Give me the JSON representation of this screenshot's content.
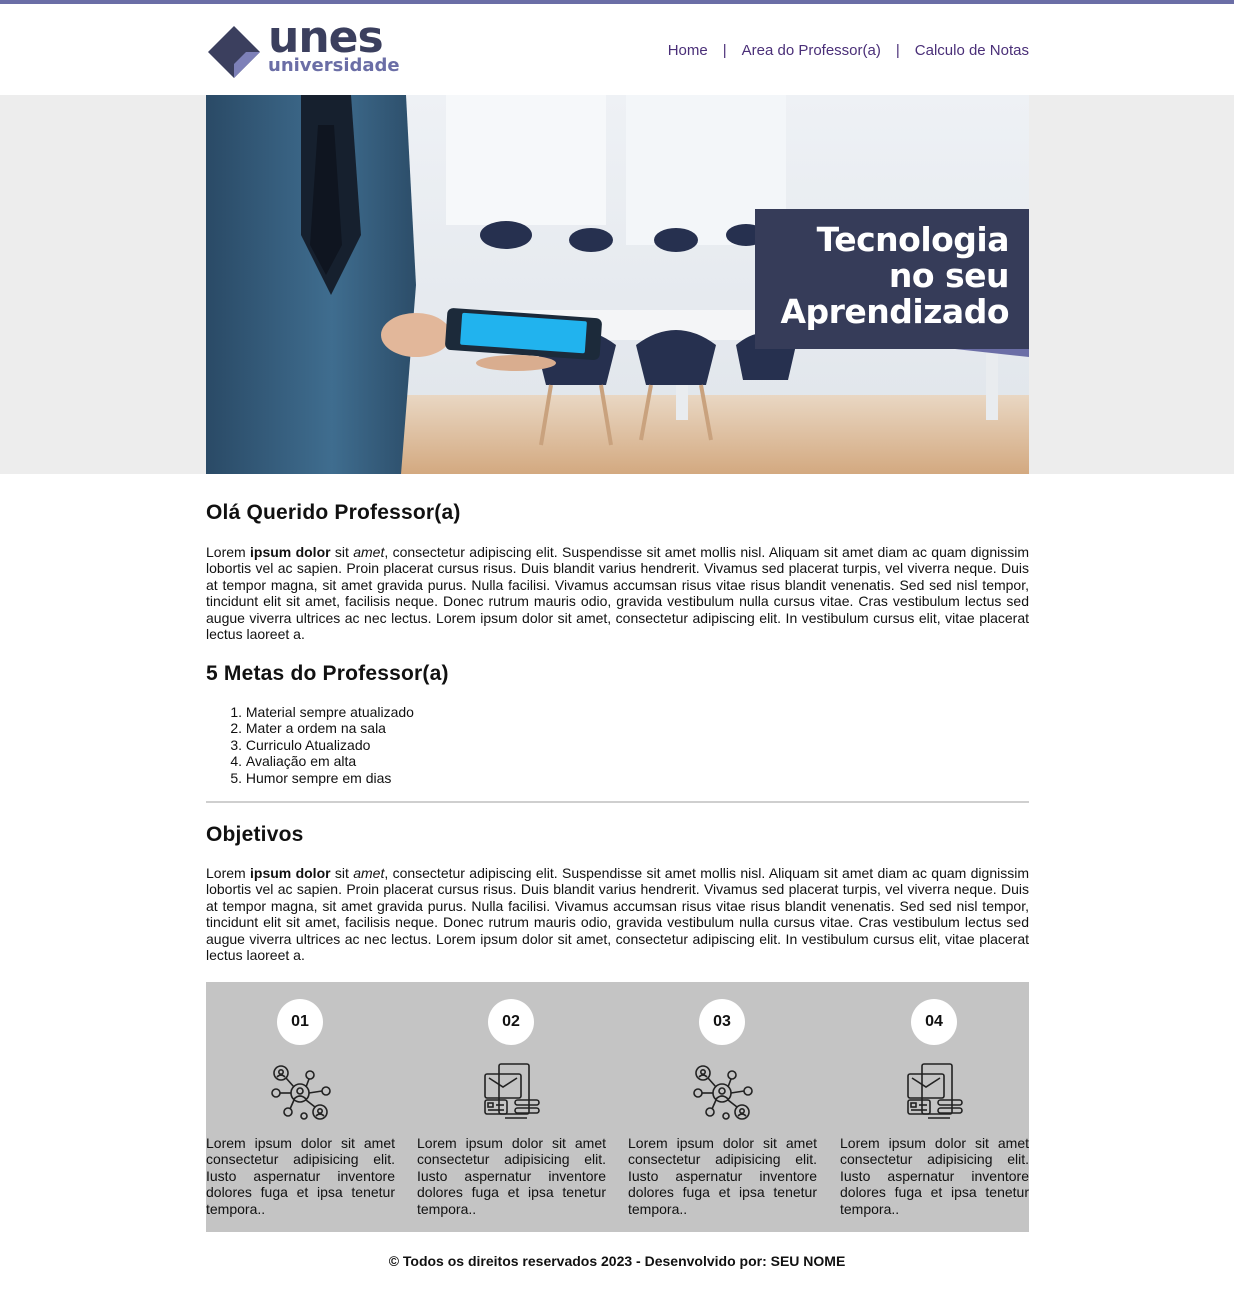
{
  "header": {
    "logo": {
      "main": "unes",
      "sub": "universidade"
    },
    "nav": [
      "Home",
      "Area do Professor(a)",
      "Calculo de Notas"
    ],
    "nav_separator": "|"
  },
  "banner": {
    "lines": [
      "Tecnologia",
      "no seu",
      "Aprendizado"
    ]
  },
  "intro": {
    "title": "Olá Querido Professor(a)",
    "text_lead": "Lorem ",
    "text_bold": "ipsum dolor",
    "text_mid": " sit ",
    "text_italic": "amet",
    "text_rest": ", consectetur adipiscing elit. Suspendisse sit amet mollis nisl. Aliquam sit amet diam ac quam dignissim lobortis vel ac sapien. Proin placerat cursus risus. Duis blandit varius hendrerit. Vivamus sed placerat turpis, vel viverra neque. Duis at tempor magna, sit amet gravida purus. Nulla facilisi. Vivamus accumsan risus vitae risus blandit venenatis. Sed sed nisl tempor, tincidunt elit sit amet, facilisis neque. Donec rutrum mauris odio, gravida vestibulum nulla cursus vitae. Cras vestibulum lectus sed augue viverra ultrices ac nec lectus. Lorem ipsum dolor sit amet, consectetur adipiscing elit. In vestibulum cursus elit, vitae placerat lectus laoreet a."
  },
  "goals": {
    "title": "5 Metas do Professor(a)",
    "items": [
      {
        "n": "1.",
        "text": "Material sempre atualizado"
      },
      {
        "n": "2.",
        "text": "Mater a ordem na sala"
      },
      {
        "n": "3.",
        "text": "Curriculo Atualizado"
      },
      {
        "n": "4.",
        "text": "Avaliação em alta"
      },
      {
        "n": "5.",
        "text": "Humor sempre em dias"
      }
    ]
  },
  "objectives": {
    "title": "Objetivos",
    "text_lead": "Lorem ",
    "text_bold": "ipsum dolor",
    "text_mid": " sit ",
    "text_italic": "amet",
    "text_rest": ", consectetur adipiscing elit. Suspendisse sit amet mollis nisl. Aliquam sit amet diam ac quam dignissim lobortis vel ac sapien. Proin placerat cursus risus. Duis blandit varius hendrerit. Vivamus sed placerat turpis, vel viverra neque. Duis at tempor magna, sit amet gravida purus. Nulla facilisi. Vivamus accumsan risus vitae risus blandit venenatis. Sed sed nisl tempor, tincidunt elit sit amet, facilisis neque. Donec rutrum mauris odio, gravida vestibulum nulla cursus vitae. Cras vestibulum lectus sed augue viverra ultrices ac nec lectus. Lorem ipsum dolor sit amet, consectetur adipiscing elit. In vestibulum cursus elit, vitae placerat lectus laoreet a."
  },
  "cards": [
    {
      "number": "01",
      "icon": "network-users-icon",
      "text": "Lorem ipsum dolor sit amet consectetur adipisicing elit. Iusto aspernatur inventore dolores fuga et ipsa tenetur tempora.."
    },
    {
      "number": "02",
      "icon": "documents-icon",
      "text": "Lorem ipsum dolor sit amet consectetur adipisicing elit. Iusto aspernatur inventore dolores fuga et ipsa tenetur tempora.."
    },
    {
      "number": "03",
      "icon": "network-users-icon",
      "text": "Lorem ipsum dolor sit amet consectetur adipisicing elit. Iusto aspernatur inventore dolores fuga et ipsa tenetur tempora.."
    },
    {
      "number": "04",
      "icon": "documents-icon",
      "text": "Lorem ipsum dolor sit amet consectetur adipisicing elit. Iusto aspernatur inventore dolores fuga et ipsa tenetur tempora.."
    }
  ],
  "footer": {
    "text": "© Todos os direitos reservados 2023 - Desenvolvido por: SEU NOME"
  },
  "colors": {
    "brand_dark": "#3b3f5e",
    "brand_light": "#6b6ea6",
    "nav_link": "#4a2f78",
    "banner_box": "#363c59",
    "cards_bg": "#c4c4c4"
  }
}
